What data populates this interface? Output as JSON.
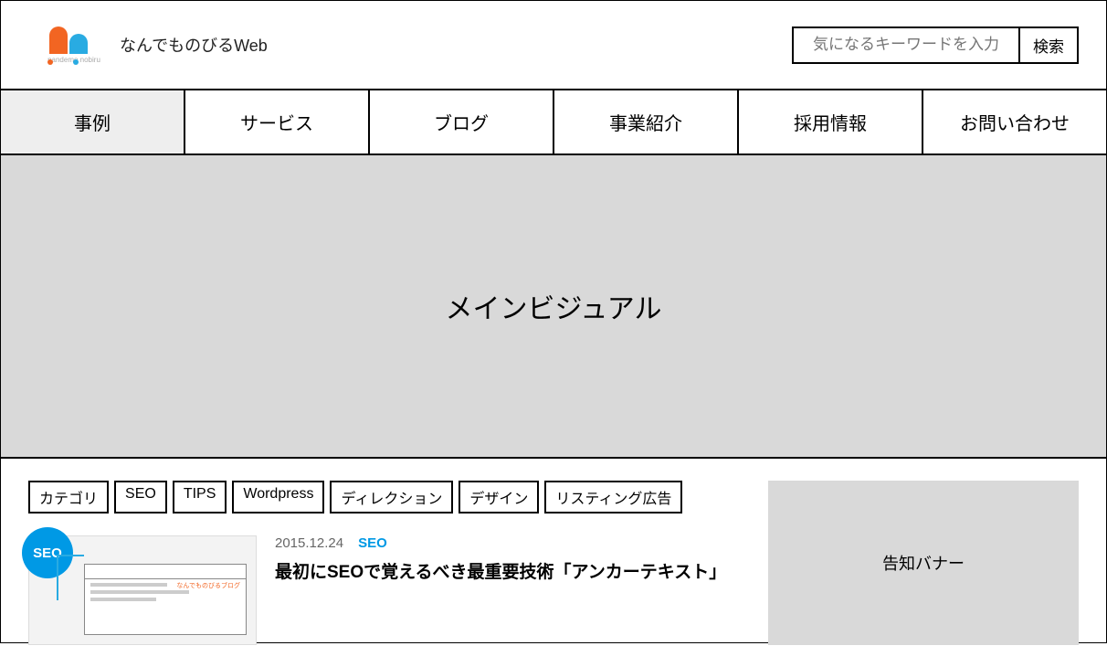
{
  "header": {
    "site_title": "なんでものびるWeb",
    "logo_sub": "nandemo nobiru",
    "search_placeholder": "気になるキーワードを入力",
    "search_button": "検索"
  },
  "nav": {
    "items": [
      "事例",
      "サービス",
      "ブログ",
      "事業紹介",
      "採用情報",
      "お問い合わせ"
    ],
    "active_index": 0
  },
  "hero": {
    "text": "メインビジュアル"
  },
  "categories": {
    "label": "カテゴリ",
    "items": [
      "SEO",
      "TIPS",
      "Wordpress",
      "ディレクション",
      "デザイン",
      "リスティング広告"
    ]
  },
  "article": {
    "date": "2015.12.24",
    "category": "SEO",
    "badge": "SEO",
    "title": "最初にSEOで覚えるべき最重要技術「アンカーテキスト」",
    "thumb_logo": "なんでものびるブログ"
  },
  "sidebar": {
    "banner_text": "告知バナー"
  }
}
